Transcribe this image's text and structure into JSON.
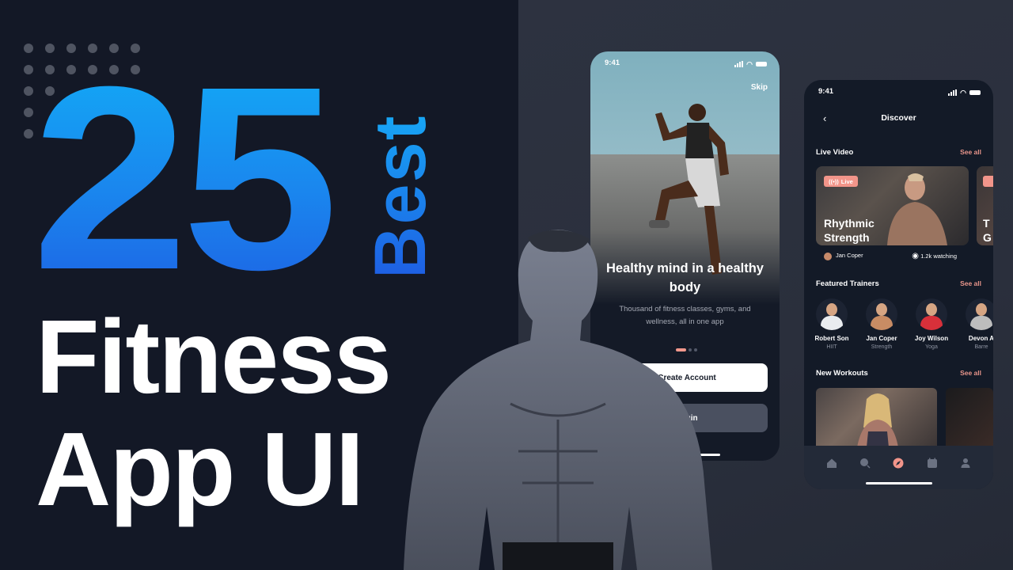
{
  "thumbnail": {
    "number": "25",
    "vertical_word": "Best",
    "title_line_1": "Fitness",
    "title_line_2": "App UI",
    "colors": {
      "background_left": "#131826",
      "background_right": "#2d3240",
      "number_gradient_top": "#12adf6",
      "number_gradient_bottom": "#1e60e3",
      "title": "#ffffff",
      "accent": "#f2958a"
    }
  },
  "onboarding_screen": {
    "status_time": "9:41",
    "skip_label": "Skip",
    "headline": "Healthy mind in a healthy body",
    "subtitle": "Thousand of fitness classes, gyms, and wellness, all in one app",
    "pager": {
      "current": 1,
      "total": 3
    },
    "create_account_label": "Create Account",
    "login_label": "Login"
  },
  "discover_screen": {
    "status_time": "9:41",
    "title": "Discover",
    "back_icon": "chevron-left-icon",
    "live_video": {
      "heading": "Live Video",
      "see_all": "See all",
      "cards": [
        {
          "badge": "Live",
          "title": "Rhythmic Strength",
          "trainer": "Jan Coper",
          "watching": "1.2k watching"
        },
        {
          "badge": "Live",
          "title": "T G",
          "trainer": "",
          "watching": ""
        }
      ]
    },
    "featured_trainers": {
      "heading": "Featured Trainers",
      "see_all": "See all",
      "items": [
        {
          "name": "Robert Son",
          "role": "HIIT",
          "shirt": "#e9ecef"
        },
        {
          "name": "Jan Coper",
          "role": "Strength",
          "shirt": "#c88c64"
        },
        {
          "name": "Joy Wilson",
          "role": "Yoga",
          "shirt": "#d8303a"
        },
        {
          "name": "Devon A",
          "role": "Barre",
          "shirt": "#bdbdbd"
        }
      ]
    },
    "new_workouts": {
      "heading": "New Workouts",
      "see_all": "See all"
    },
    "tabbar": [
      {
        "icon": "home-icon",
        "active": false
      },
      {
        "icon": "search-icon",
        "active": false
      },
      {
        "icon": "compass-icon",
        "active": true
      },
      {
        "icon": "calendar-icon",
        "active": false
      },
      {
        "icon": "profile-icon",
        "active": false
      }
    ]
  }
}
